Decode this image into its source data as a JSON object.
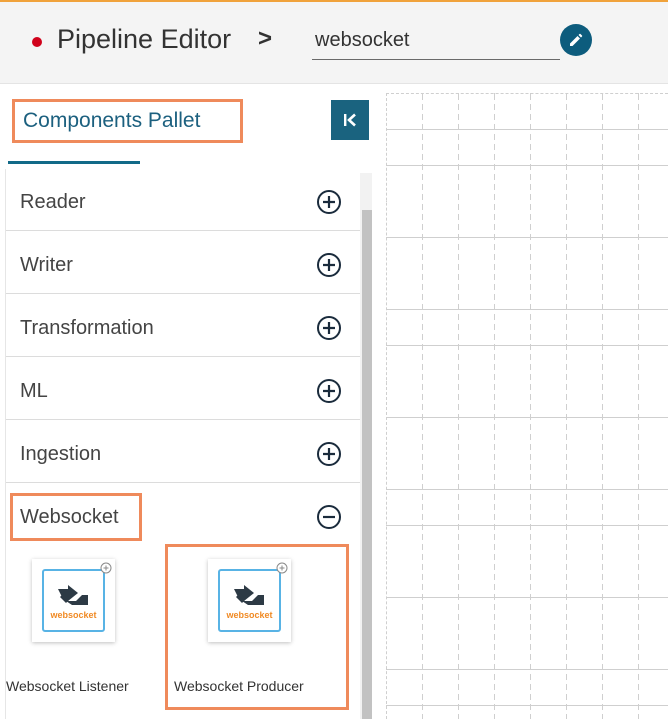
{
  "header": {
    "title": "Pipeline Editor",
    "breadcrumb_separator": ">",
    "pipeline_name": "websocket",
    "status_color": "#d0021b"
  },
  "sidebar": {
    "title": "Components Pallet",
    "collapse_icon": "collapse-left-icon",
    "categories": [
      {
        "label": "Reader",
        "state": "collapsed"
      },
      {
        "label": "Writer",
        "state": "collapsed"
      },
      {
        "label": "Transformation",
        "state": "collapsed"
      },
      {
        "label": "ML",
        "state": "collapsed"
      },
      {
        "label": "Ingestion",
        "state": "collapsed"
      },
      {
        "label": "Websocket",
        "state": "expanded"
      }
    ],
    "components": [
      {
        "label": "Websocket Listener",
        "icon_text": "websocket"
      },
      {
        "label": "Websocket Producer",
        "icon_text": "websocket"
      }
    ]
  },
  "colors": {
    "accent": "#1a637f",
    "highlight": "#ef8a5b",
    "icon_orange": "#f08a24"
  }
}
